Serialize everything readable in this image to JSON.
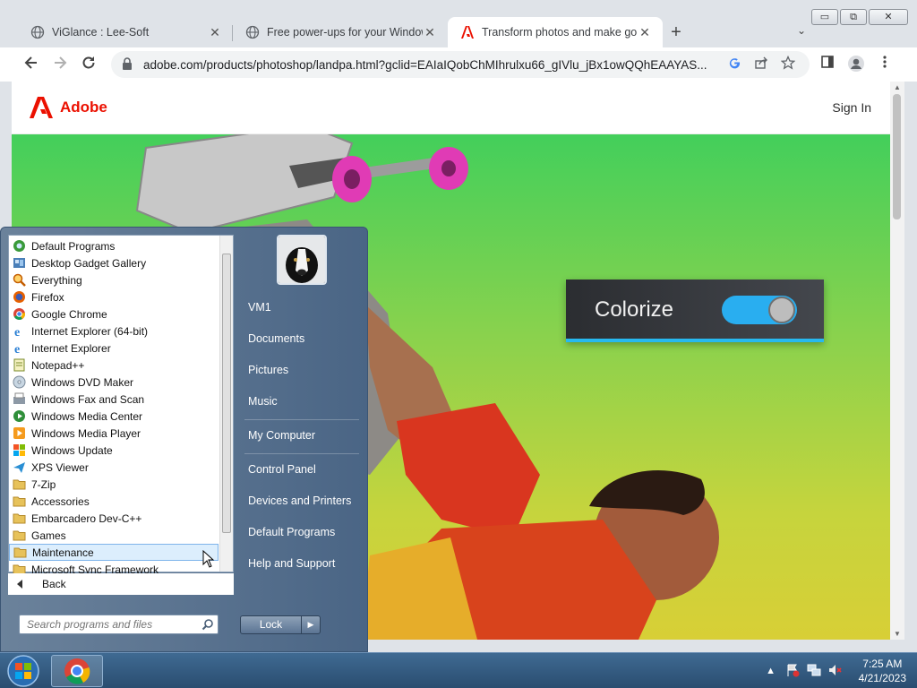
{
  "window": {
    "minimize": "▭",
    "restore": "⧉",
    "close": "✕"
  },
  "tabs": [
    {
      "title": "ViGlance : Lee-Soft",
      "icon": "globe-icon"
    },
    {
      "title": "Free power-ups for your Window",
      "icon": "globe-icon"
    },
    {
      "title": "Transform photos and make gorge",
      "icon": "adobe-icon",
      "active": true
    }
  ],
  "tab_close": "✕",
  "new_tab": "+",
  "tab_search": "⌄",
  "address": {
    "url": "adobe.com/products/photoshop/landpa.html?gclid=EAIaIQobChMIhrulxu66_gIVlu_jBx1owQQhEAAYAS..."
  },
  "page": {
    "brand": "Adobe",
    "sign_in": "Sign In",
    "hero": {
      "toggle_label": "Colorize",
      "toggle_on": true
    }
  },
  "start_menu": {
    "programs": [
      {
        "label": "Default Programs",
        "icon": "default-programs-icon"
      },
      {
        "label": "Desktop Gadget Gallery",
        "icon": "gadget-icon"
      },
      {
        "label": "Everything",
        "icon": "magnifier-icon"
      },
      {
        "label": "Firefox",
        "icon": "firefox-icon"
      },
      {
        "label": "Google Chrome",
        "icon": "chrome-icon"
      },
      {
        "label": "Internet Explorer (64-bit)",
        "icon": "ie-icon"
      },
      {
        "label": "Internet Explorer",
        "icon": "ie-icon"
      },
      {
        "label": "Notepad++",
        "icon": "notepad-icon"
      },
      {
        "label": "Windows DVD Maker",
        "icon": "dvd-icon"
      },
      {
        "label": "Windows Fax and Scan",
        "icon": "fax-icon"
      },
      {
        "label": "Windows Media Center",
        "icon": "media-center-icon"
      },
      {
        "label": "Windows Media Player",
        "icon": "media-player-icon"
      },
      {
        "label": "Windows Update",
        "icon": "update-icon"
      },
      {
        "label": "XPS Viewer",
        "icon": "xps-icon"
      },
      {
        "label": "7-Zip",
        "icon": "folder-icon"
      },
      {
        "label": "Accessories",
        "icon": "folder-icon"
      },
      {
        "label": "Embarcadero Dev-C++",
        "icon": "folder-icon"
      },
      {
        "label": "Games",
        "icon": "folder-icon"
      },
      {
        "label": "Maintenance",
        "icon": "folder-icon",
        "highlighted": true
      },
      {
        "label": "Microsoft Sync Framework",
        "icon": "folder-icon"
      }
    ],
    "back": "Back",
    "search_placeholder": "Search programs and files",
    "right_items": [
      "VM1",
      "Documents",
      "Pictures",
      "Music",
      "My Computer",
      "Control Panel",
      "Devices and Printers",
      "Default Programs",
      "Help and Support"
    ],
    "lock": "Lock"
  },
  "taskbar": {
    "clock_time": "7:25 AM",
    "clock_date": "4/21/2023"
  }
}
